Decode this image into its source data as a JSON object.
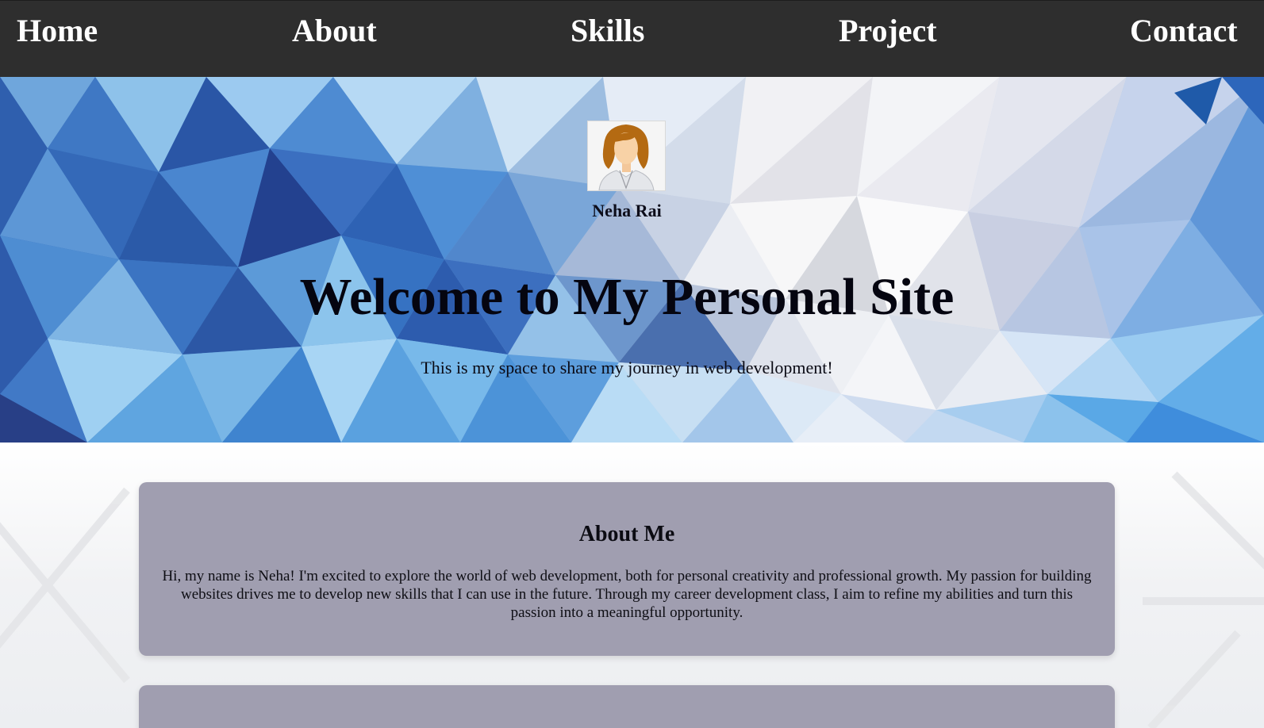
{
  "nav": {
    "items": [
      {
        "label": "Home"
      },
      {
        "label": "About"
      },
      {
        "label": "Skills"
      },
      {
        "label": "Project"
      },
      {
        "label": "Contact"
      }
    ]
  },
  "hero": {
    "name": "Neha Rai",
    "title": "Welcome to My Personal Site",
    "subtitle": "This is my space to share my journey in web development!",
    "avatar_icon": "female-avatar-icon"
  },
  "about": {
    "heading": "About Me",
    "text": "Hi, my name is Neha! I'm excited to explore the world of web development, both for personal creativity and professional growth. My passion for building websites drives me to develop new skills that I can use in the future. Through my career development class, I aim to refine my abilities and turn this passion into a meaningful opportunity."
  },
  "colors": {
    "nav_bg": "#2e2e2e",
    "nav_text": "#ffffff",
    "card_bg": "#a09eb0",
    "hero_primary": "#3a6fbf"
  }
}
